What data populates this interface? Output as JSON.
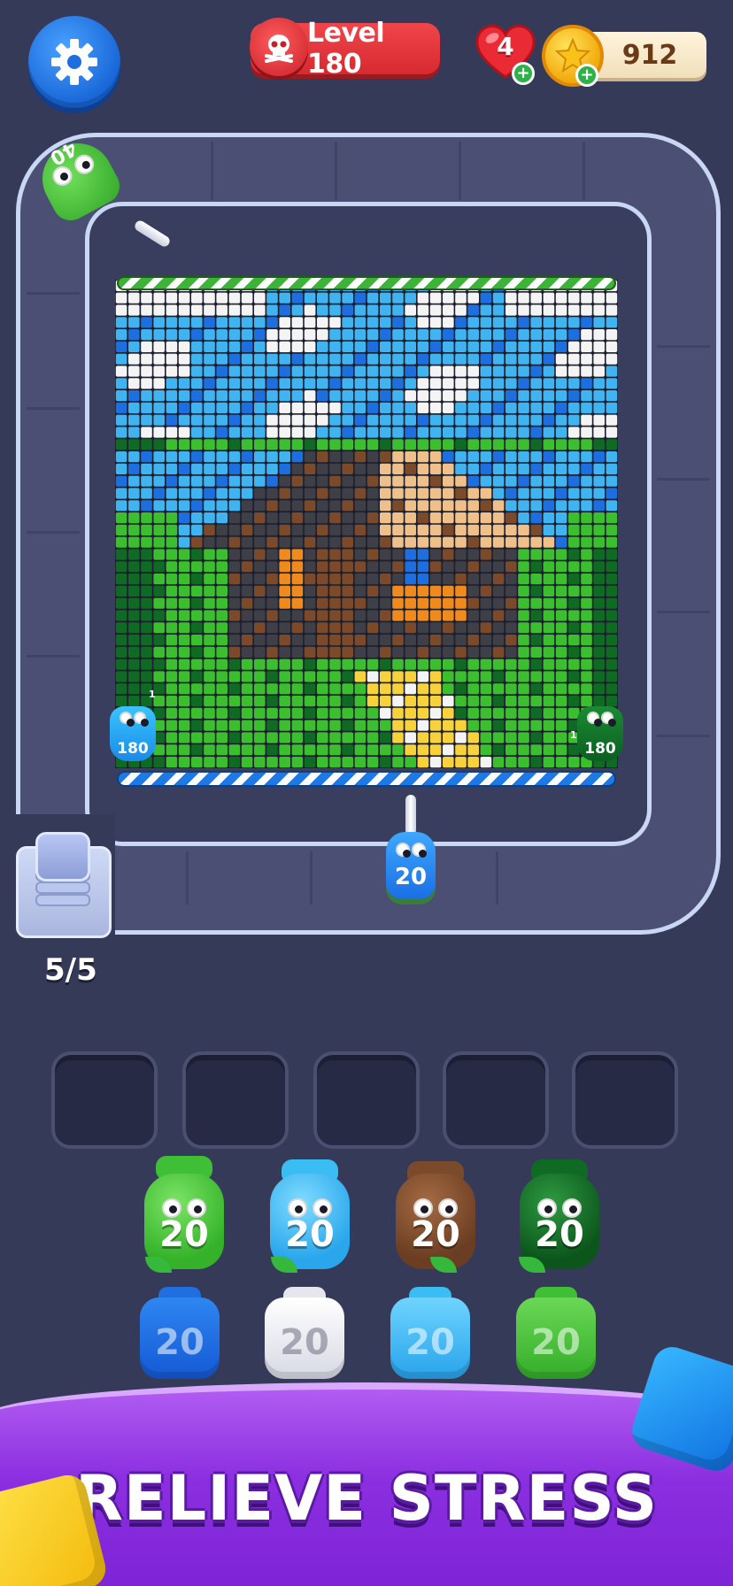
{
  "hud": {
    "settings_icon": "gear-icon",
    "level_label": "Level 180",
    "level_icon": "skull-icon",
    "lives": "4",
    "lives_icon": "heart-icon",
    "coins": "912",
    "coin_icon": "star-coin-icon"
  },
  "track": {
    "corner_bottle_count": "40",
    "shooter_count": "20",
    "left_bottle_count": "180",
    "right_bottle_count": "180",
    "left_small_label": "1",
    "right_small_label": "1"
  },
  "queue": {
    "count": "5/5"
  },
  "slots": {
    "total": 5
  },
  "tray": {
    "row1": [
      {
        "label": "20",
        "color": "green"
      },
      {
        "label": "20",
        "color": "cyan"
      },
      {
        "label": "20",
        "color": "brown"
      },
      {
        "label": "20",
        "color": "dark-green"
      }
    ],
    "row2": [
      {
        "label": "20",
        "color": "blue"
      },
      {
        "label": "20",
        "color": "white"
      },
      {
        "label": "20",
        "color": "cyan"
      },
      {
        "label": "20",
        "color": "green"
      }
    ]
  },
  "banner": {
    "text": "RELIEVE STRESS"
  },
  "colors": {
    "background": "#363a59",
    "level_red": "#e03a40",
    "coin_gold": "#f5b81c",
    "banner_purple": "#8b2fe0",
    "white": "#f4f4f4",
    "sky": "#3fb4f0",
    "blue": "#1d6fe0",
    "grass": "#3cbf2e",
    "dark_green": "#0f6a24",
    "roof": "#f0c08a",
    "brown": "#7a4a2a",
    "dark_gray": "#3e3f47",
    "orange": "#f08a1c",
    "yellow": "#f7d23a"
  }
}
